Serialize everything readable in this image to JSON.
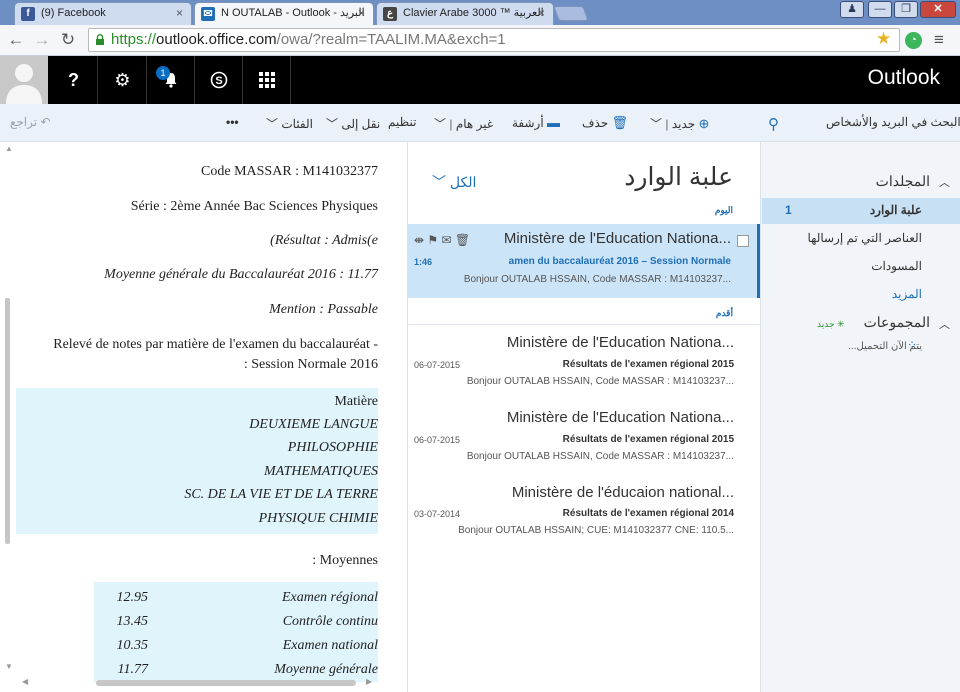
{
  "browser": {
    "tabs": [
      {
        "label": "(9) Facebook",
        "favicon": "f",
        "favicon_color": "#3b5998"
      },
      {
        "label": "N OUTALAB - Outlook - البريد",
        "favicon": "✉",
        "favicon_color": "#1e6fb8"
      },
      {
        "label": "Clavier Arabe 3000 ™ العربية",
        "favicon": "ع",
        "favicon_color": "#444444"
      }
    ],
    "url_scheme": "https://",
    "url_host": "outlook.office.com",
    "url_path": "/owa/?realm=TAALIM.MA&exch=1"
  },
  "header": {
    "app_title": "Outlook",
    "notification_count": "1"
  },
  "command_bar": {
    "new_label": "جديد",
    "delete_label": "حذف",
    "archive_label": "أرشفة",
    "junk_label": "غير هام",
    "sweep_label": "تنظيم",
    "move_label": "نقل إلى",
    "categories_label": "الفئات",
    "more_label": "•••",
    "undo_label": "تراجع",
    "search_label": "البحث في البريد والأشخاص"
  },
  "folders": {
    "folders_heading": "المجلدات",
    "inbox_label": "علبة الوارد",
    "inbox_count": "1",
    "sent_label": "العناصر التي تم إرسالها",
    "drafts_label": "المسودات",
    "more_label": "المزيد",
    "groups_heading": "المجموعات",
    "groups_new": "جديد",
    "loading_label": "يتم الآن التحميل..."
  },
  "message_list": {
    "title": "علبة الوارد",
    "filter_label": "الكل",
    "group_today": "اليوم",
    "group_older": "أقدم",
    "messages": [
      {
        "sender": "Ministère de l'Education Nationa...",
        "subject": "amen du baccalauréat 2016 – Session Normale",
        "date": "1:46",
        "preview": "Bonjour OUTALAB HSSAIN,  Code MASSAR : M14103237..."
      },
      {
        "sender": "Ministère de l'Education Nationa...",
        "subject": "Résultats de l'examen régional 2015",
        "date": "06-07-2015",
        "preview": "Bonjour OUTALAB HSSAIN,  Code MASSAR : M14103237..."
      },
      {
        "sender": "Ministère de l'Education Nationa...",
        "subject": "Résultats de l'examen régional 2015",
        "date": "06-07-2015",
        "preview": "Bonjour OUTALAB HSSAIN,  Code MASSAR : M14103237..."
      },
      {
        "sender": "Ministère de l'éducaion national...",
        "subject": "Résultats de l'examen régional 2014",
        "date": "03-07-2014",
        "preview": "Bonjour OUTALAB HSSAIN;  CUE: M141032377 CNE: 110.5..."
      }
    ]
  },
  "reading_pane": {
    "code_massar": "Code MASSAR : M141032377",
    "serie": "Série : 2ème Année Bac Sciences Physiques",
    "resultat": "(Résultat : Admis(e",
    "moyenne_generale": "Moyenne générale du Baccalauréat 2016 : 11.77",
    "mention": "Mention : Passable",
    "releve_line1": "Relevé de notes par matière de l'examen du baccalauréat -",
    "releve_line2": ": Session Normale 2016",
    "subjects_header": "Matière",
    "subjects": [
      "DEUXIEME LANGUE",
      "PHILOSOPHIE",
      "MATHEMATIQUES",
      "SC. DE LA VIE ET DE LA TERRE",
      "PHYSIQUE CHIMIE"
    ],
    "moyennes_label": ": Moyennes",
    "moyennes": [
      {
        "label": "Examen régional",
        "value": "12.95"
      },
      {
        "label": "Contrôle continu",
        "value": "13.45"
      },
      {
        "label": "Examen national",
        "value": "10.35"
      },
      {
        "label": "Moyenne générale",
        "value": "11.77"
      }
    ]
  },
  "colors": {
    "accent": "#1e6fb8",
    "selection": "#cce4f7",
    "table_bg": "#dff4fb",
    "header_bg": "#000000"
  }
}
